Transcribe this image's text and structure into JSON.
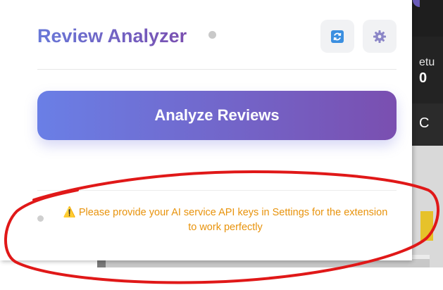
{
  "app": {
    "title": "Review Analyzer"
  },
  "header": {
    "refresh_icon": "refresh-icon",
    "settings_icon": "gear-icon"
  },
  "main": {
    "analyze_button_label": "Analyze Reviews"
  },
  "footer": {
    "warning_icon": "⚠️",
    "warning_text": "Please provide your AI service API keys in Settings for the extension to work perfectly"
  },
  "background_page": {
    "text_a": "etu",
    "text_b": "0",
    "text_c": "C"
  },
  "colors": {
    "title_gradient_start": "#6878d8",
    "title_gradient_end": "#7a4fb0",
    "button_gradient_start": "#6a7fe6",
    "button_gradient_end": "#7a4fb0",
    "warning": "#e8930c",
    "annotation": "#e01818"
  }
}
